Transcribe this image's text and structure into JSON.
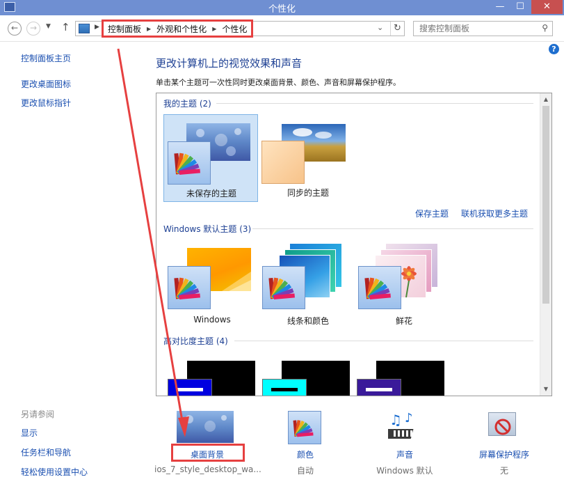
{
  "window": {
    "title": "个性化"
  },
  "nav": {
    "crumbs": [
      "控制面板",
      "外观和个性化",
      "个性化"
    ],
    "search_placeholder": "搜索控制面板"
  },
  "left": {
    "links": [
      "控制面板主页",
      "更改桌面图标",
      "更改鼠标指针"
    ],
    "see_also_caption": "另请参阅",
    "see_also": [
      "显示",
      "任务栏和导航",
      "轻松使用设置中心"
    ]
  },
  "main": {
    "heading": "更改计算机上的视觉效果和声音",
    "description": "单击某个主题可一次性同时更改桌面背景、颜色、声音和屏幕保护程序。",
    "groups": {
      "mine": "我的主题 (2)",
      "default": "Windows 默认主题 (3)",
      "hc": "高对比度主题 (4)"
    },
    "my_themes": [
      "未保存的主题",
      "同步的主题"
    ],
    "default_themes": [
      "Windows",
      "线条和颜色",
      "鲜花"
    ],
    "actions": [
      "保存主题",
      "联机获取更多主题"
    ]
  },
  "bottom": [
    {
      "label": "桌面背景",
      "sub": "ios_7_style_desktop_wa..."
    },
    {
      "label": "颜色",
      "sub": "自动"
    },
    {
      "label": "声音",
      "sub": "Windows 默认"
    },
    {
      "label": "屏幕保护程序",
      "sub": "无"
    }
  ],
  "colors": {
    "hc1": "#0000e0",
    "hc2": "#00ffff",
    "hc3": "#3a1a9a",
    "accent_red": "#e64040",
    "link": "#1a4fb0"
  }
}
